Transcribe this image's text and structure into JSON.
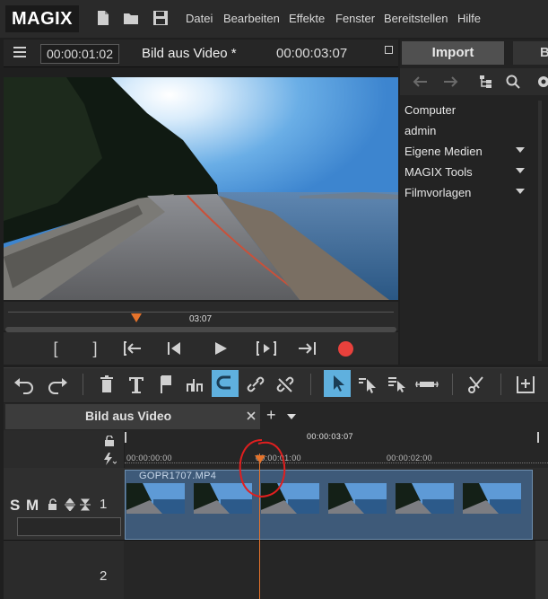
{
  "app": {
    "logo": "MAGIX"
  },
  "menu": [
    "Datei",
    "Bearbeiten",
    "Effekte",
    "Fenster",
    "Bereitstellen",
    "Hilfe"
  ],
  "preview": {
    "position_timecode": "00:00:01:02",
    "title": "Bild aus Video *",
    "duration_timecode": "00:00:03:07",
    "scrub_label": "03:07"
  },
  "transport": {
    "mark_in": "[",
    "mark_out": "]"
  },
  "media_panel": {
    "tab_import": "Import",
    "tab_second": "B",
    "items": [
      {
        "label": "Computer",
        "expandable": false
      },
      {
        "label": "admin",
        "expandable": false
      },
      {
        "label": "Eigene Medien",
        "expandable": true
      },
      {
        "label": "MAGIX Tools",
        "expandable": true
      },
      {
        "label": "Filmvorlagen",
        "expandable": true
      }
    ]
  },
  "timeline": {
    "tab_title": "Bild aus Video",
    "add_label": "+",
    "range_label": "00:00:03:07",
    "ruler_marks": [
      "00:00:00:00",
      "00:00:01:00",
      "00:00:02:00"
    ],
    "track1": {
      "number": "1",
      "solo": "S",
      "mute": "M",
      "clip_name": "GOPR1707.MP4"
    },
    "track2": {
      "number": "2"
    }
  },
  "colors": {
    "accent": "#e5732b",
    "record": "#e8413c",
    "selected_tool": "#5fb0de",
    "clip": "#3e5a79"
  }
}
